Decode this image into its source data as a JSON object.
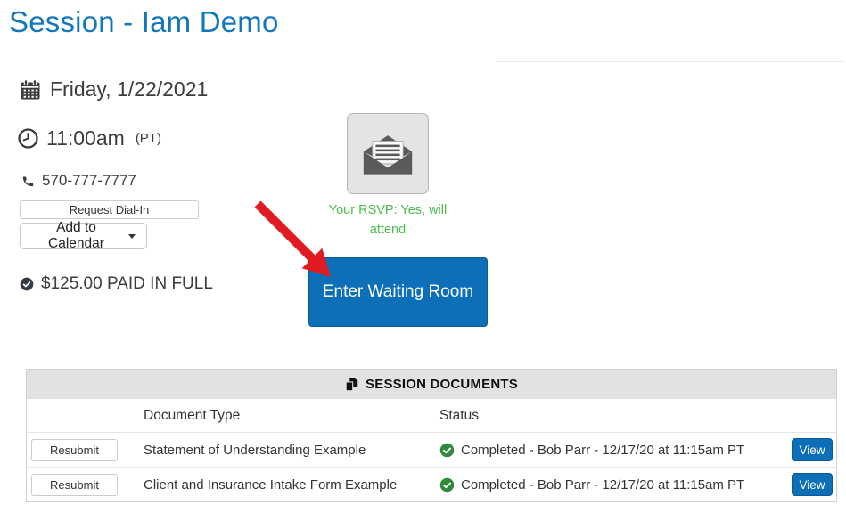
{
  "page": {
    "title": "Session - Iam Demo"
  },
  "session": {
    "date": "Friday, 1/22/2021",
    "time": "11:00am",
    "timezone": "(PT)",
    "phone": "570-777-7777",
    "request_dial_in_label": "Request Dial-In",
    "add_to_calendar_label": "Add to Calendar",
    "payment_status": "$125.00 PAID IN FULL",
    "rsvp_status": "Your RSVP: Yes, will attend",
    "enter_waiting_room_label": "Enter Waiting Room"
  },
  "documents": {
    "title": "SESSION DOCUMENTS",
    "columns": {
      "document_type": "Document Type",
      "status": "Status"
    },
    "resubmit_label": "Resubmit",
    "view_label": "View",
    "rows": [
      {
        "document_type": "Statement of Understanding Example",
        "status": "Completed - Bob Parr - 12/17/20 at 11:15am PT"
      },
      {
        "document_type": "Client and Insurance Intake Form Example",
        "status": "Completed - Bob Parr - 12/17/20 at 11:15am PT"
      }
    ]
  },
  "colors": {
    "title_blue": "#1277bd",
    "button_blue": "#0d6fb7",
    "rsvp_green": "#4abd4c",
    "completed_green": "#318a3c",
    "arrow_red": "#e01b22",
    "table_header_bg": "#e2e2e2"
  }
}
